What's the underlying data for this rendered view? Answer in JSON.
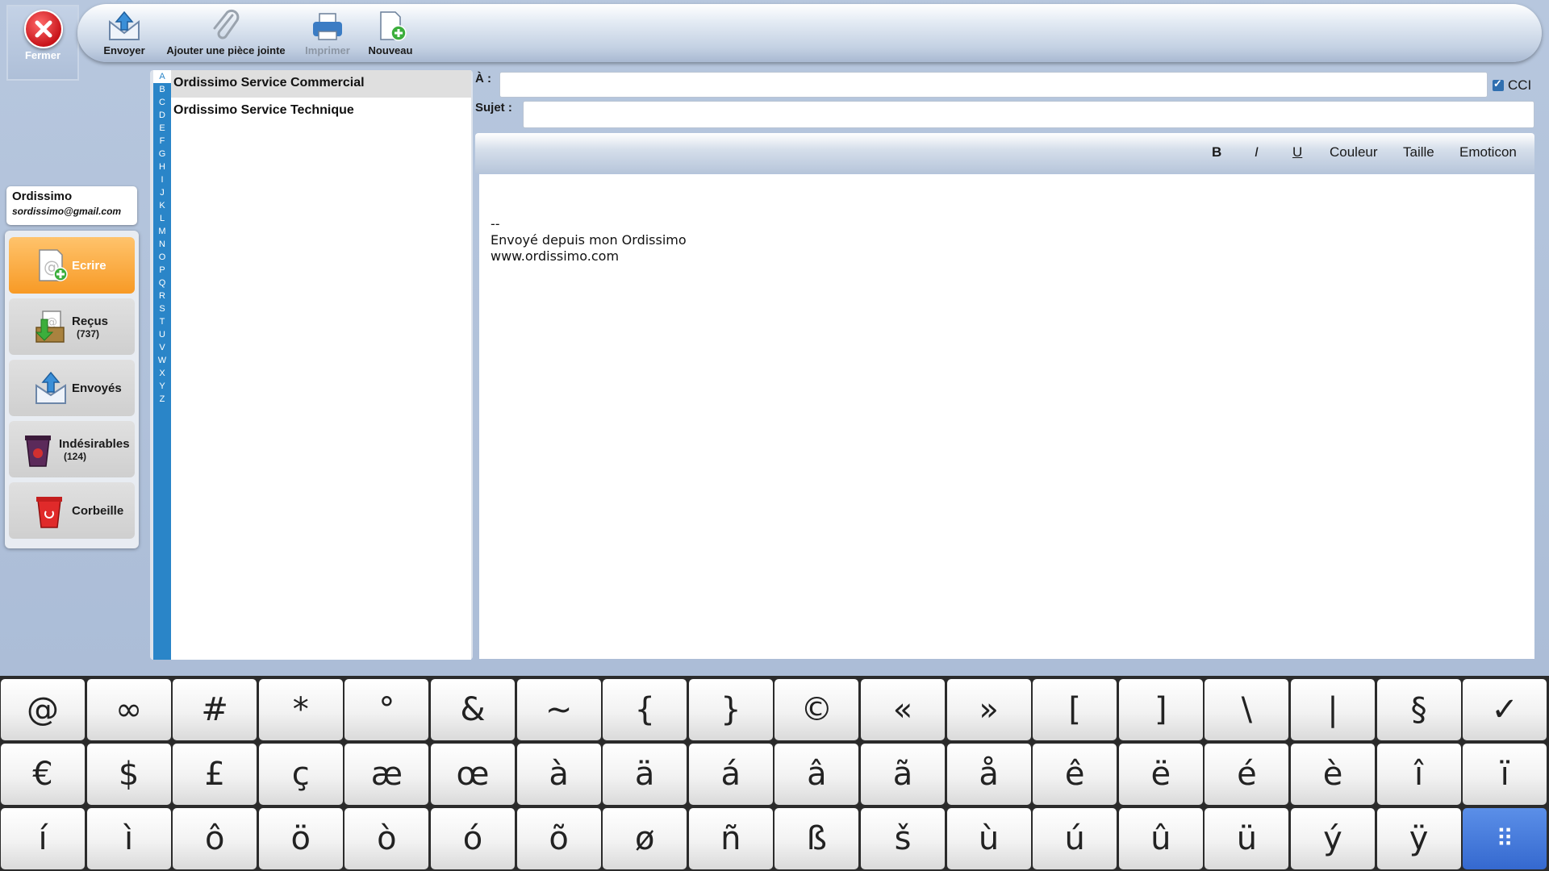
{
  "toolbar": {
    "close_label": "Fermer",
    "send_label": "Envoyer",
    "attach_label": "Ajouter une pièce jointe",
    "print_label": "Imprimer",
    "new_label": "Nouveau"
  },
  "account": {
    "name": "Ordissimo",
    "email": "sordissimo@gmail.com"
  },
  "nav": [
    {
      "label": "Ecrire",
      "count": "",
      "icon": "compose-icon",
      "active": true
    },
    {
      "label": "Reçus",
      "count": "(737)",
      "icon": "inbox-icon",
      "active": false
    },
    {
      "label": "Envoyés",
      "count": "",
      "icon": "sent-icon",
      "active": false
    },
    {
      "label": "Indésirables",
      "count": "(124)",
      "icon": "spam-icon",
      "active": false
    },
    {
      "label": "Corbeille",
      "count": "",
      "icon": "trash-icon",
      "active": false
    }
  ],
  "alphabet": [
    "A",
    "B",
    "C",
    "D",
    "E",
    "F",
    "G",
    "H",
    "I",
    "J",
    "K",
    "L",
    "M",
    "N",
    "O",
    "P",
    "Q",
    "R",
    "S",
    "T",
    "U",
    "V",
    "W",
    "X",
    "Y",
    "Z"
  ],
  "contacts": [
    "Ordissimo Service Commercial",
    "Ordissimo Service Technique"
  ],
  "compose": {
    "to_label": "À :",
    "to_value": "",
    "cci_label": "CCI",
    "subject_label": "Sujet :",
    "subject_value": "",
    "format_bold": "B",
    "format_italic": "I",
    "format_underline": "U",
    "format_color": "Couleur",
    "format_size": "Taille",
    "format_emoticon": "Emoticon",
    "signature": "--\nEnvoyé depuis mon Ordissimo\nwww.ordissimo.com"
  },
  "keyboard": {
    "rows": [
      [
        "@",
        "∞",
        "#",
        "*",
        "°",
        "&",
        "~",
        "{",
        "}",
        "©",
        "«",
        "»",
        "[",
        "]",
        "\\",
        "|",
        "§",
        "✓"
      ],
      [
        "€",
        "$",
        "£",
        "ç",
        "æ",
        "œ",
        "à",
        "ä",
        "á",
        "â",
        "ã",
        "å",
        "ê",
        "ë",
        "é",
        "è",
        "î",
        "ï"
      ],
      [
        "í",
        "ì",
        "ô",
        "ö",
        "ò",
        "ó",
        "õ",
        "ø",
        "ñ",
        "ß",
        "š",
        "ù",
        "ú",
        "û",
        "ü",
        "ý",
        "ÿ",
        "⠿"
      ]
    ]
  },
  "colors": {
    "accent_blue": "#2a85c8",
    "active_orange": "#f79a26",
    "close_red": "#c8141a"
  }
}
